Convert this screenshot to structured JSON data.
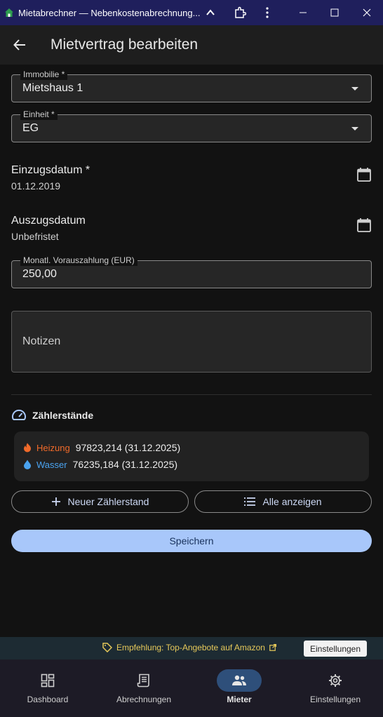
{
  "window": {
    "title": "Mietabrechner — Nebenkostenabrechnung...",
    "icons": [
      "home-icon",
      "chevron-up-icon",
      "extensions-icon",
      "more-vert-icon",
      "minimize-icon",
      "maximize-icon",
      "close-icon"
    ]
  },
  "appbar": {
    "title": "Mietvertrag bearbeiten"
  },
  "form": {
    "property": {
      "label": "Immobilie *",
      "value": "Mietshaus 1"
    },
    "unit": {
      "label": "Einheit *",
      "value": "EG"
    },
    "move_in": {
      "label": "Einzugsdatum *",
      "value": "01.12.2019"
    },
    "move_out": {
      "label": "Auszugsdatum",
      "value": "Unbefristet"
    },
    "prepayment": {
      "label": "Monatl. Vorauszahlung (EUR)",
      "value": "250,00"
    },
    "notes": {
      "placeholder": "Notizen"
    }
  },
  "meters": {
    "heading": "Zählerstände",
    "readings": [
      {
        "name": "Heizung",
        "value": "97823,214 (31.12.2025)",
        "color": "#f06a2a"
      },
      {
        "name": "Wasser",
        "value": "76235,184 (31.12.2025)",
        "color": "#4aa3f0"
      }
    ],
    "new_button": "Neuer Zählerstand",
    "all_button": "Alle anzeigen"
  },
  "save_button": "Speichern",
  "adbar": {
    "text": "Empfehlung: Top-Angebote auf Amazon",
    "settings_button": "Einstellungen"
  },
  "nav": [
    {
      "label": "Dashboard",
      "icon": "dashboard-icon",
      "active": false
    },
    {
      "label": "Abrechnungen",
      "icon": "receipt-icon",
      "active": false
    },
    {
      "label": "Mieter",
      "icon": "people-icon",
      "active": true
    },
    {
      "label": "Einstellungen",
      "icon": "settings-icon",
      "active": false
    }
  ],
  "colors": {
    "accent": "#a8c7fa",
    "titlebar": "#1f1f5c",
    "ad_text": "#e6c95a"
  }
}
